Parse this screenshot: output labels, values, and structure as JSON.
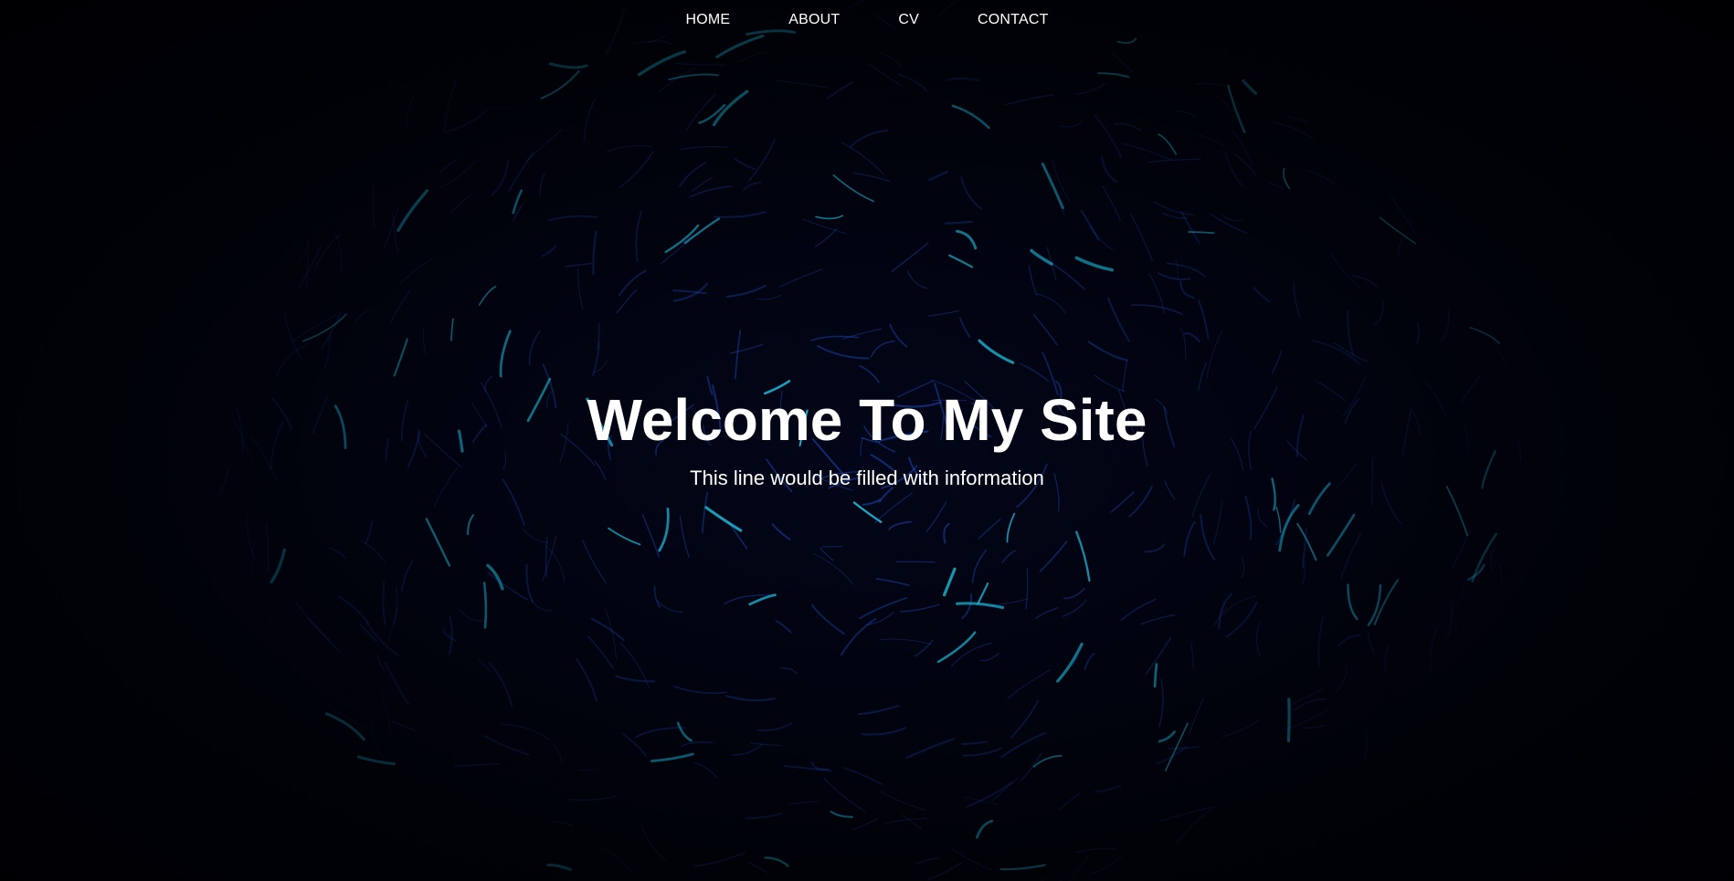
{
  "nav": {
    "items": [
      {
        "label": "HOME"
      },
      {
        "label": "ABOUT"
      },
      {
        "label": "CV"
      },
      {
        "label": "CONTACT"
      }
    ]
  },
  "hero": {
    "title": "Welcome To My Site",
    "subtitle": "This line would be filled with information"
  },
  "theme": {
    "background": "#000106",
    "text_color": "#ffffff",
    "streak_cyan": "#1fc8e8",
    "streak_blue": "#1f4fc8"
  }
}
